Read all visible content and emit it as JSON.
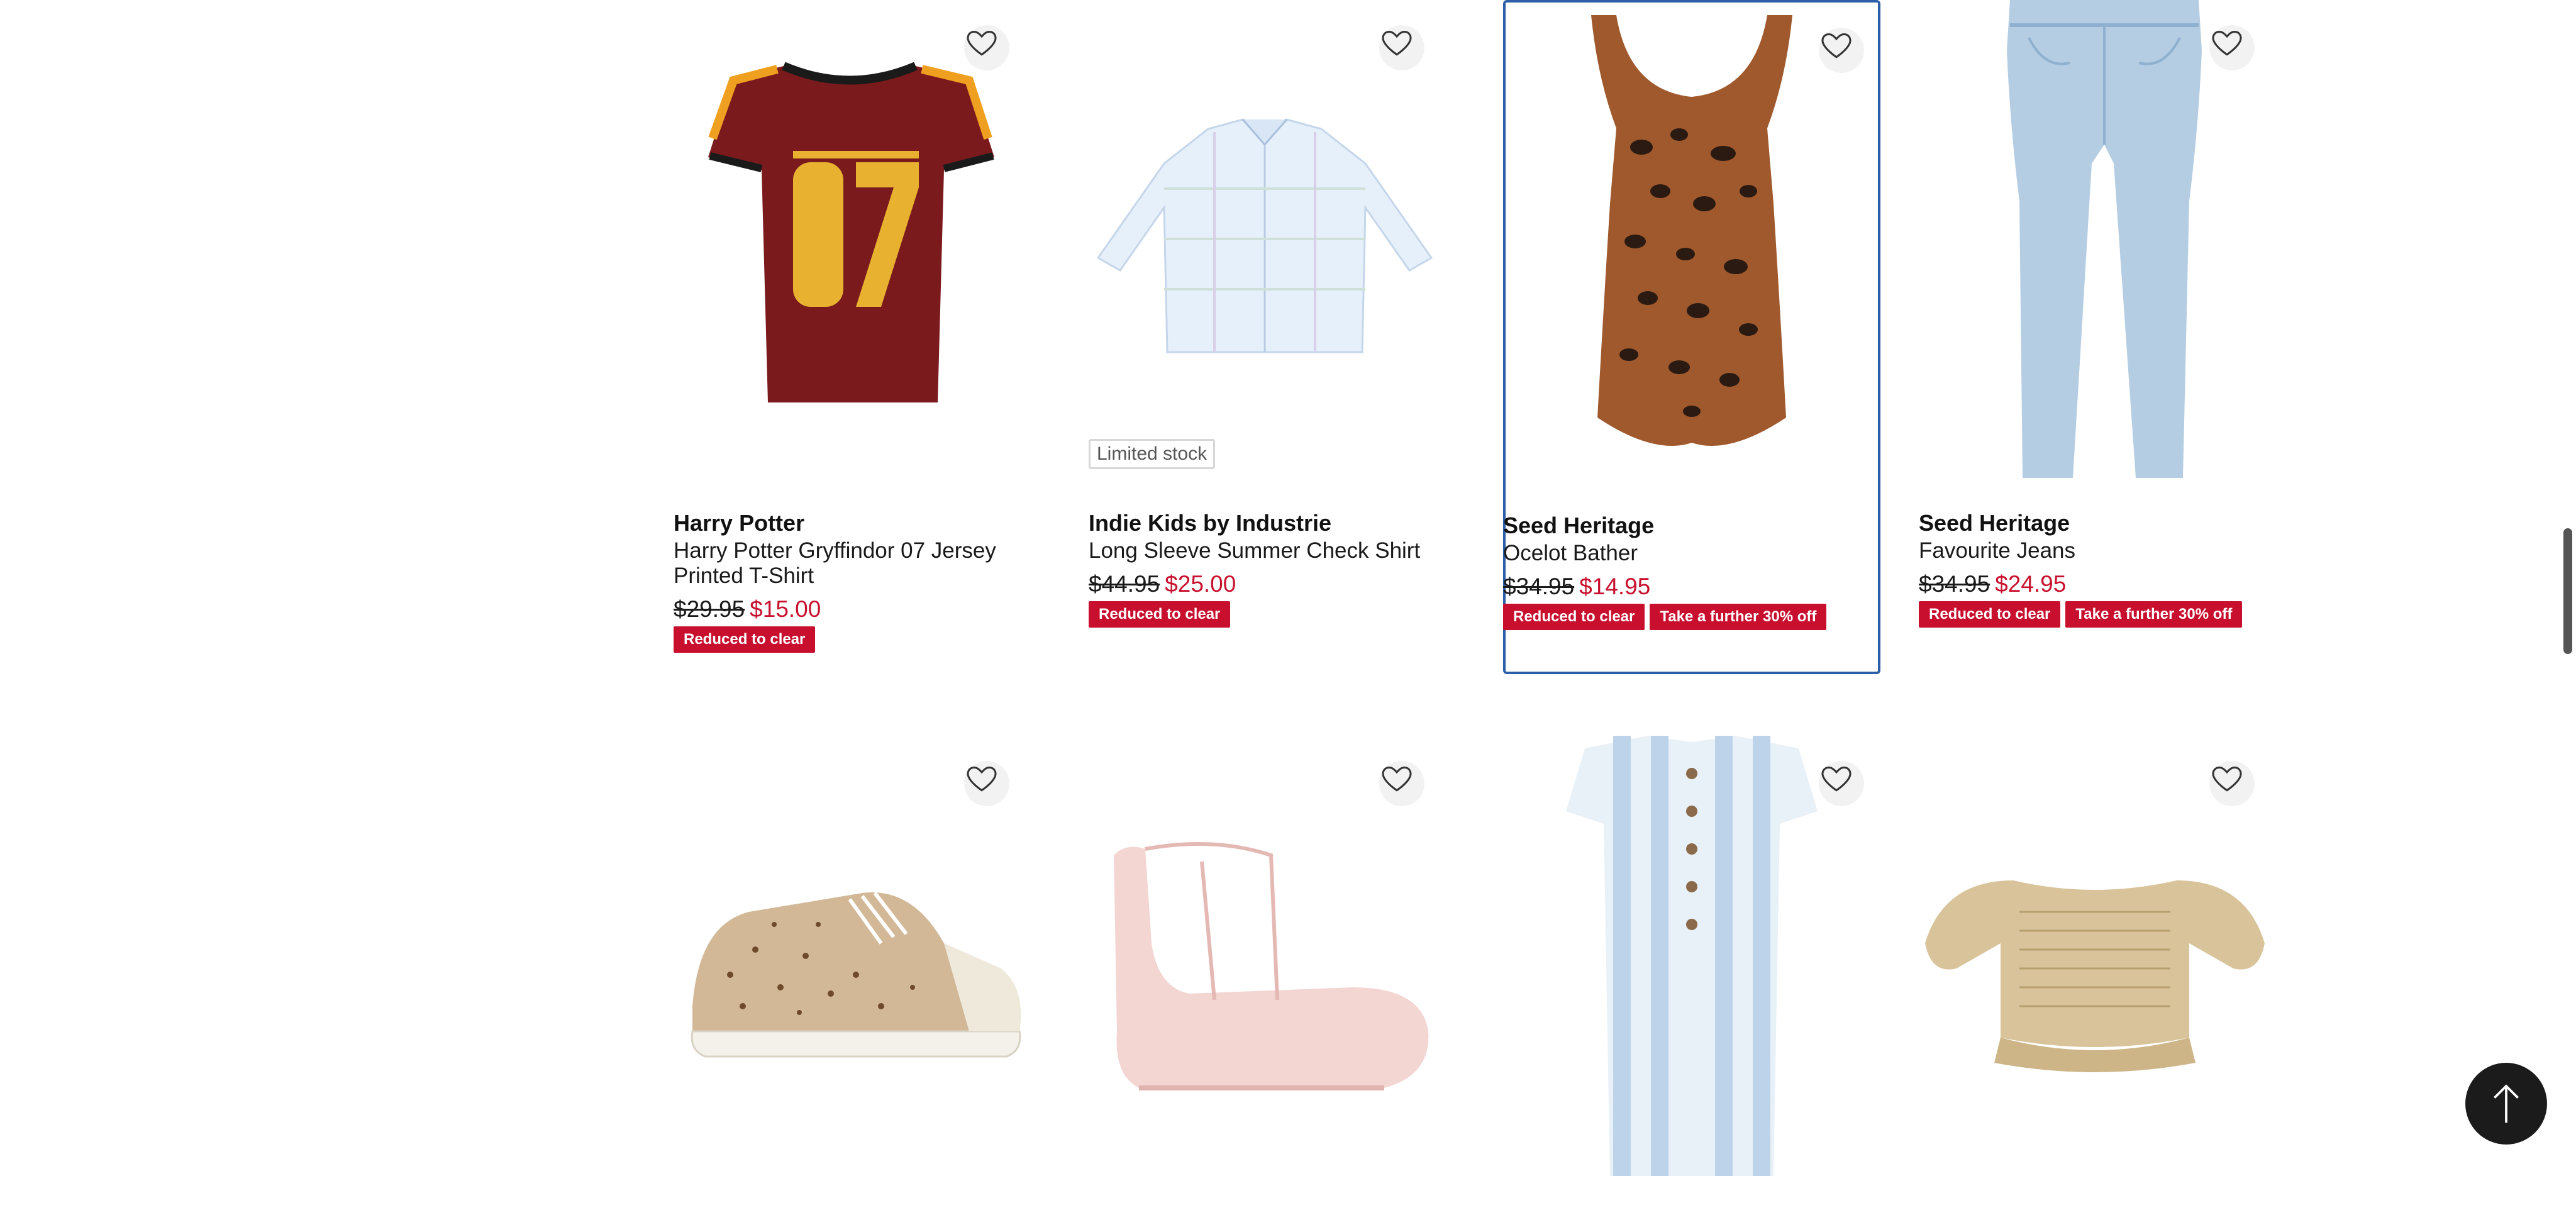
{
  "products": [
    {
      "brand": "Harry Potter",
      "title": "Harry Potter Gryffindor 07 Jersey Printed T-Shirt",
      "was_price": "$29.95",
      "now_price": "$15.00",
      "tags": [
        "Reduced to clear"
      ],
      "image": "red-gryffindor-tshirt"
    },
    {
      "brand": "Indie Kids by Industrie",
      "title": "Long Sleeve Summer Check Shirt",
      "was_price": "$44.95",
      "now_price": "$25.00",
      "tags": [
        "Reduced to clear"
      ],
      "badge": "Limited stock",
      "image": "blue-check-shirt"
    },
    {
      "brand": "Seed Heritage",
      "title": "Ocelot Bather",
      "was_price": "$34.95",
      "now_price": "$14.95",
      "tags": [
        "Reduced to clear",
        "Take a further 30% off"
      ],
      "image": "leopard-swimsuit"
    },
    {
      "brand": "Seed Heritage",
      "title": "Favourite Jeans",
      "was_price": "$34.95",
      "now_price": "$24.95",
      "tags": [
        "Reduced to clear",
        "Take a further 30% off"
      ],
      "image": "light-blue-jeans"
    },
    {
      "image": "leopard-sneaker"
    },
    {
      "image": "pink-baby-boot"
    },
    {
      "image": "striped-jumpsuit"
    },
    {
      "image": "beige-puff-top"
    }
  ],
  "icons": {
    "wishlist": "heart-outline-icon",
    "back_to_top": "arrow-up-icon"
  },
  "colors": {
    "sale_red": "#c8102e",
    "focus_border": "#2d5ea8",
    "back_to_top_bg": "#1b1b1b"
  }
}
